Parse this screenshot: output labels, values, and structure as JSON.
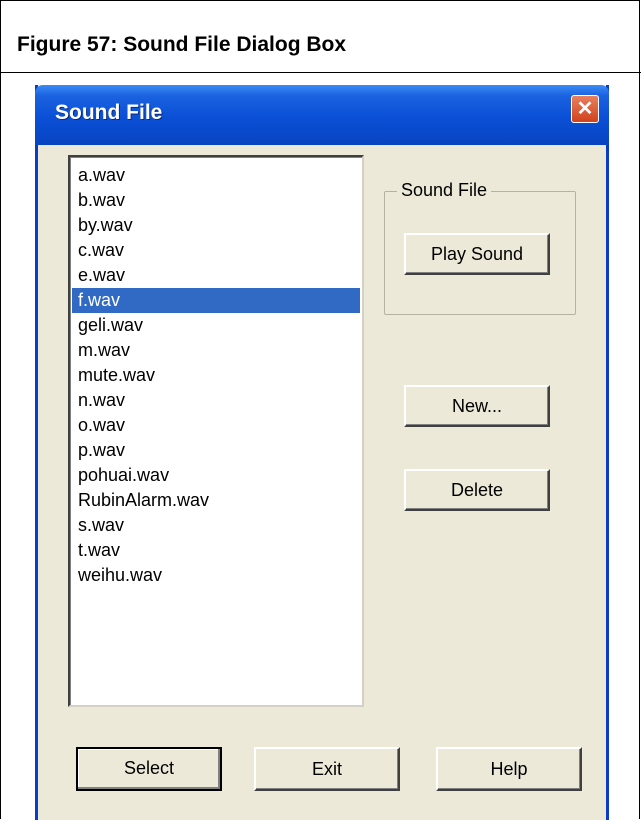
{
  "caption": "Figure 57:  Sound File Dialog Box",
  "dialog": {
    "title": "Sound File",
    "close_icon": "close-icon",
    "close_glyph": "✕"
  },
  "file_list": {
    "items": [
      "a.wav",
      "b.wav",
      "by.wav",
      "c.wav",
      "e.wav",
      "f.wav",
      "geli.wav",
      "m.wav",
      "mute.wav",
      "n.wav",
      "o.wav",
      "p.wav",
      "pohuai.wav",
      "RubinAlarm.wav",
      "s.wav",
      "t.wav",
      "weihu.wav"
    ],
    "selected_index": 5,
    "selection_color": "#316ac5"
  },
  "sound_group": {
    "label": "Sound File",
    "play_label": "Play Sound"
  },
  "actions": {
    "new_label": "New...",
    "delete_label": "Delete"
  },
  "bottom": {
    "select_label": "Select",
    "exit_label": "Exit",
    "help_label": "Help"
  }
}
